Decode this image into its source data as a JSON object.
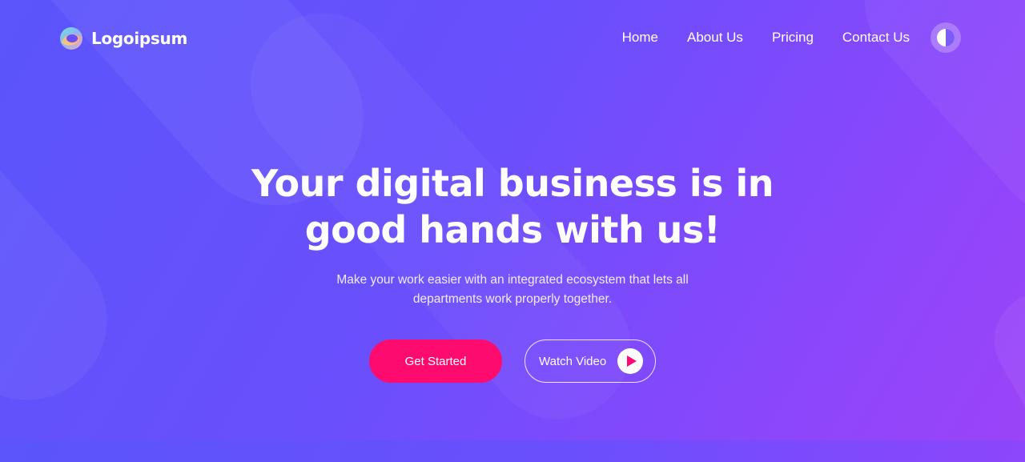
{
  "brand": {
    "name": "Logoipsum",
    "icon": "logo-icon"
  },
  "nav": {
    "items": [
      {
        "label": "Home"
      },
      {
        "label": "About Us"
      },
      {
        "label": "Pricing"
      },
      {
        "label": "Contact Us"
      }
    ],
    "theme_toggle_icon": "contrast-icon"
  },
  "hero": {
    "title": "Your digital business is in good hands with us!",
    "subtitle": "Make your work easier with an integrated ecosystem that lets all departments work properly together.",
    "primary_cta": "Get Started",
    "secondary_cta": "Watch Video",
    "secondary_icon": "play-icon"
  },
  "colors": {
    "background_start": "#5b55fb",
    "background_end": "#9b44f8",
    "primary_button": "#fd0b6f",
    "play_icon": "#fd0b6f"
  }
}
